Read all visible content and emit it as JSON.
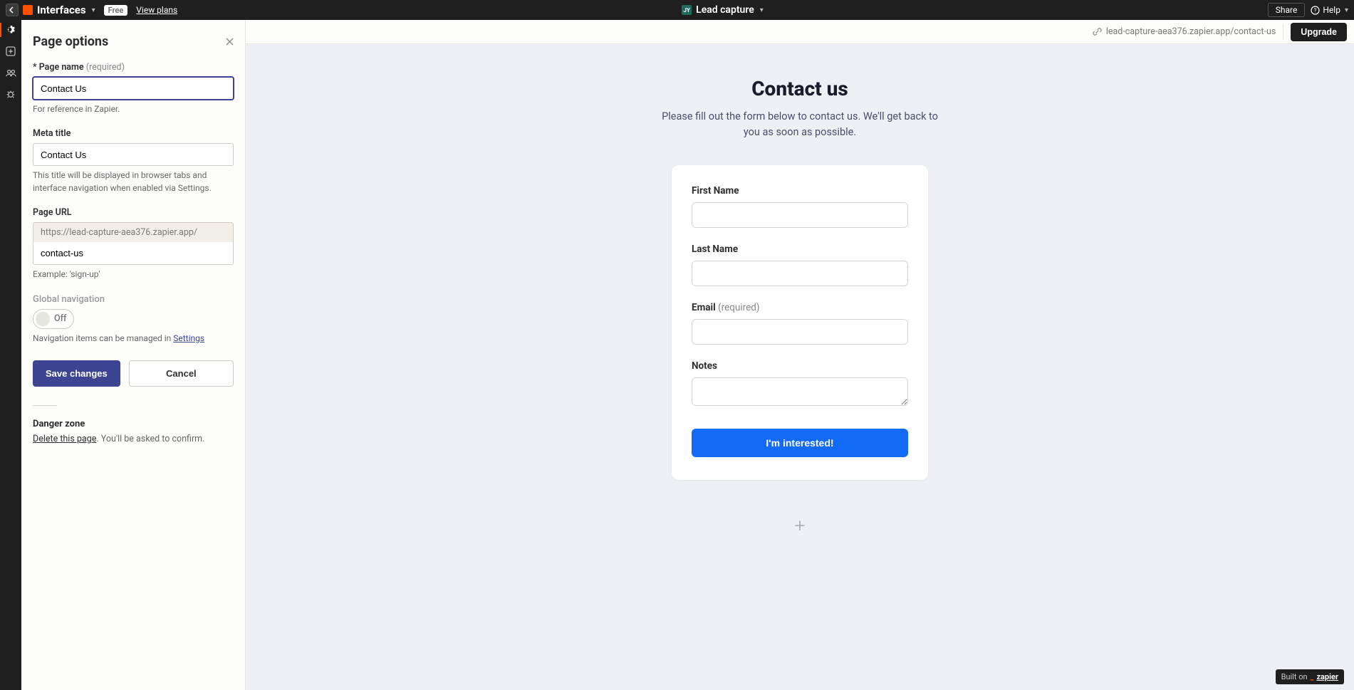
{
  "topbar": {
    "brand": "Interfaces",
    "plan_badge": "Free",
    "view_plans": "View plans",
    "avatar_initials": "JY",
    "app_name": "Lead capture",
    "share": "Share",
    "help": "Help"
  },
  "subheader": {
    "page_url": "lead-capture-aea376.zapier.app/contact-us",
    "upgrade": "Upgrade"
  },
  "sidebar": {
    "title": "Page options",
    "page_name_label": "Page name",
    "page_name_required": "(required)",
    "page_name_value": "Contact Us",
    "page_name_help": "For reference in Zapier.",
    "meta_title_label": "Meta title",
    "meta_title_value": "Contact Us",
    "meta_title_help": "This title will be displayed in browser tabs and interface navigation when enabled via Settings.",
    "page_url_label": "Page URL",
    "page_url_prefix": "https://lead-capture-aea376.zapier.app/",
    "page_url_slug": "contact-us",
    "page_url_help": "Example: 'sign-up'",
    "global_nav_label": "Global navigation",
    "global_nav_state": "Off",
    "global_nav_help_prefix": "Navigation items can be managed in ",
    "global_nav_help_link": "Settings",
    "save": "Save changes",
    "cancel": "Cancel",
    "danger_title": "Danger zone",
    "danger_link": "Delete this page",
    "danger_suffix": ". You'll be asked to confirm."
  },
  "page": {
    "title": "Contact us",
    "subtitle": "Please fill out the form below to contact us. We'll get back to you as soon as possible."
  },
  "form": {
    "first_name": "First Name",
    "last_name": "Last Name",
    "email": "Email",
    "email_required": "(required)",
    "notes": "Notes",
    "submit": "I'm interested!"
  },
  "footer": {
    "built_prefix": "Built on",
    "built_brand": "zapier"
  }
}
